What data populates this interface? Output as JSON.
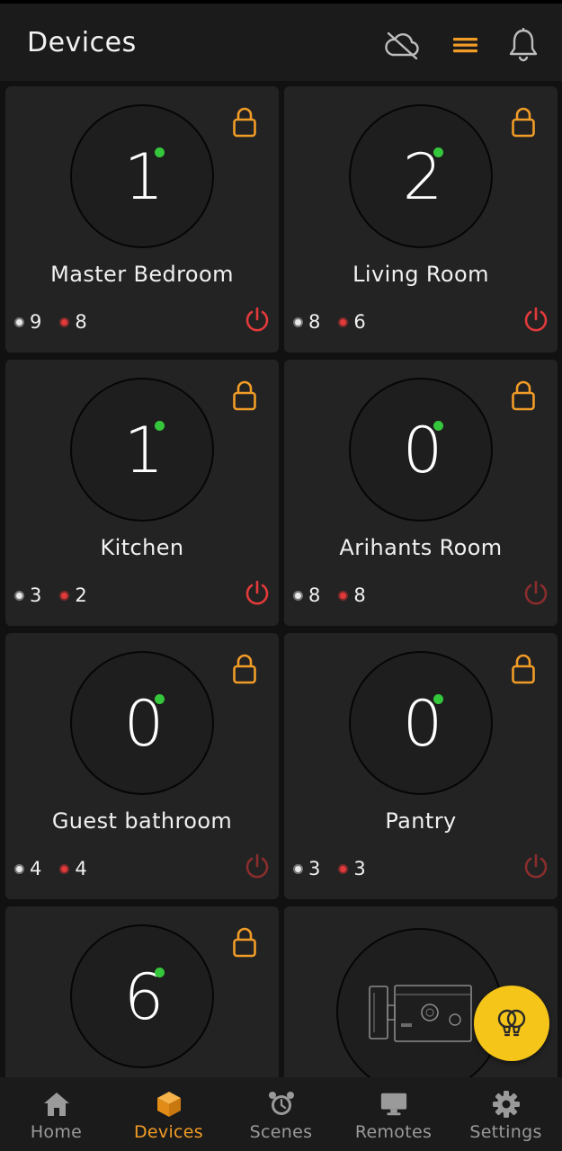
{
  "header": {
    "title": "Devices",
    "icons": [
      "cloud-off-icon",
      "menu-icon",
      "bell-icon"
    ]
  },
  "colors": {
    "accent": "#f19c27",
    "online_dot": "#35c73b",
    "power_on": "#e23a3a",
    "power_off": "#8a2d2d",
    "fab": "#f6c519"
  },
  "rooms": [
    {
      "name": "Master Bedroom",
      "count": "1",
      "white_count": "9",
      "red_count": "8",
      "power": "on"
    },
    {
      "name": "Living Room",
      "count": "2",
      "white_count": "8",
      "red_count": "6",
      "power": "on"
    },
    {
      "name": "Kitchen",
      "count": "1",
      "white_count": "3",
      "red_count": "2",
      "power": "on"
    },
    {
      "name": "Arihants Room",
      "count": "0",
      "white_count": "8",
      "red_count": "8",
      "power": "off"
    },
    {
      "name": "Guest bathroom",
      "count": "0",
      "white_count": "4",
      "red_count": "4",
      "power": "off"
    },
    {
      "name": "Pantry",
      "count": "0",
      "white_count": "3",
      "red_count": "3",
      "power": "off"
    },
    {
      "name": "",
      "count": "6",
      "white_count": "",
      "red_count": "",
      "power": ""
    }
  ],
  "camera_card": {
    "icon": "camera-device-icon"
  },
  "fab": {
    "icon": "bulbs-icon"
  },
  "nav": {
    "items": [
      {
        "label": "Home",
        "icon": "home-icon"
      },
      {
        "label": "Devices",
        "icon": "cube-icon",
        "active": true
      },
      {
        "label": "Scenes",
        "icon": "alarm-clock-icon"
      },
      {
        "label": "Remotes",
        "icon": "monitor-icon"
      },
      {
        "label": "Settings",
        "icon": "gear-icon"
      }
    ]
  }
}
